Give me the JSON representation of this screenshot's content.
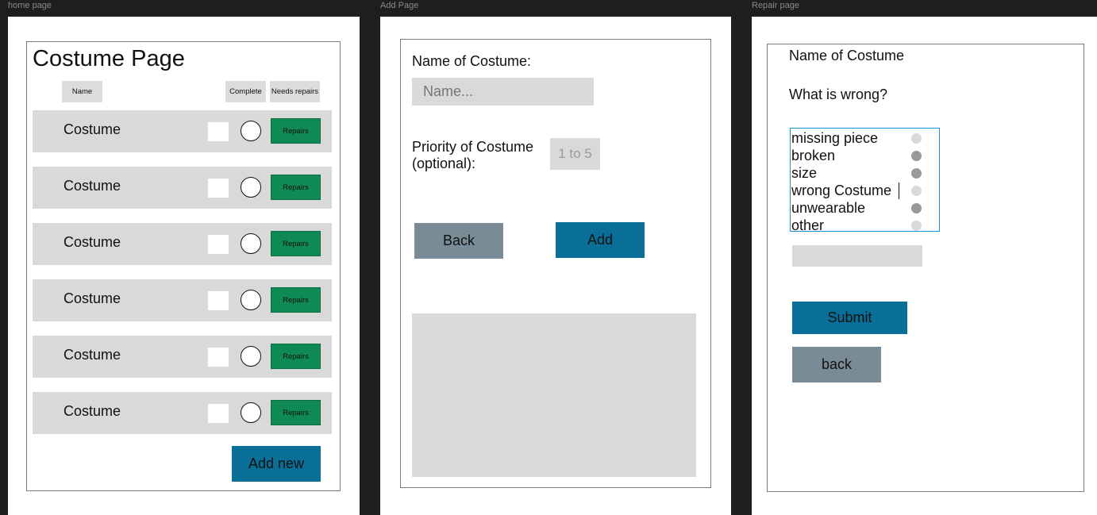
{
  "frames": {
    "home": "home page",
    "add": "Add Page",
    "repair": "Repair page"
  },
  "home": {
    "title": "Costume Page",
    "headers": {
      "name": "Name",
      "complete": "Complete",
      "needs_repairs": "Needs repairs"
    },
    "rows": [
      {
        "name": "Costume",
        "action": "Repairs"
      },
      {
        "name": "Costume",
        "action": "Repairs"
      },
      {
        "name": "Costume",
        "action": "Repairs"
      },
      {
        "name": "Costume",
        "action": "Repairs"
      },
      {
        "name": "Costume",
        "action": "Repairs"
      },
      {
        "name": "Costume",
        "action": "Repairs"
      }
    ],
    "add_new": "Add new"
  },
  "add": {
    "name_label": "Name of Costume:",
    "name_placeholder": "Name...",
    "priority_label_1": "Priority of Costume",
    "priority_label_2": "(optional):",
    "priority_placeholder": "1 to 5",
    "back": "Back",
    "add": "Add"
  },
  "repair": {
    "name_label": "Name of Costume",
    "question": "What is wrong?",
    "options": [
      {
        "label": "missing piece",
        "selected": false
      },
      {
        "label": "broken",
        "selected": true
      },
      {
        "label": "size",
        "selected": true
      },
      {
        "label": "wrong Costume",
        "selected": false
      },
      {
        "label": "unwearable",
        "selected": true
      },
      {
        "label": "other",
        "selected": false
      }
    ],
    "submit": "Submit",
    "back": "back"
  },
  "colors": {
    "primary": "#0a6f97",
    "secondary": "#788b96",
    "repairs": "#0f8a55",
    "input_bg": "#d9d9d9"
  }
}
